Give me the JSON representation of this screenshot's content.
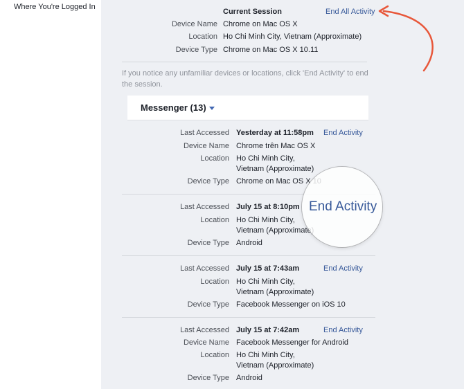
{
  "page": {
    "section_title": "Where You're Logged In"
  },
  "current_session": {
    "title": "Current Session",
    "end_all_label": "End All Activity",
    "device_name_label": "Device Name",
    "device_name": "Chrome on Mac OS X",
    "location_label": "Location",
    "location": "Ho Chi Minh City, Vietnam (Approximate)",
    "device_type_label": "Device Type",
    "device_type": "Chrome on Mac OS X 10.11"
  },
  "notice": "If you notice any unfamiliar devices or locations, click 'End Activity' to end the session.",
  "messenger": {
    "title": "Messenger (13)",
    "sessions": [
      {
        "last_accessed_label": "Last Accessed",
        "last_accessed": "Yesterday at 11:58pm",
        "end_label": "End Activity",
        "device_name_label": "Device Name",
        "device_name": "Chrome trên Mac OS X",
        "location_label": "Location",
        "location_line1": "Ho Chi Minh City,",
        "location_line2": "Vietnam (Approximate)",
        "device_type_label": "Device Type",
        "device_type": "Chrome on Mac OS X 10"
      },
      {
        "last_accessed_label": "Last Accessed",
        "last_accessed": "July 15 at 8:10pm",
        "end_label": "End Activity",
        "location_label": "Location",
        "location_line1": "Ho Chi Minh City,",
        "location_line2": "Vietnam (Approximate)",
        "device_type_label": "Device Type",
        "device_type": "Android"
      },
      {
        "last_accessed_label": "Last Accessed",
        "last_accessed": "July 15 at 7:43am",
        "end_label": "End Activity",
        "location_label": "Location",
        "location_line1": "Ho Chi Minh City,",
        "location_line2": "Vietnam (Approximate)",
        "device_type_label": "Device Type",
        "device_type": "Facebook Messenger on iOS 10"
      },
      {
        "last_accessed_label": "Last Accessed",
        "last_accessed": "July 15 at 7:42am",
        "end_label": "End Activity",
        "device_name_label": "Device Name",
        "device_name": "Facebook Messenger for Android",
        "location_label": "Location",
        "location_line1": "Ho Chi Minh City,",
        "location_line2": "Vietnam (Approximate)",
        "device_type_label": "Device Type",
        "device_type": "Android"
      }
    ]
  },
  "icons": {
    "annotation_arrow": "curved-arrow-icon",
    "dropdown": "caret-down-icon"
  },
  "colors": {
    "link": "#365899",
    "arrow": "#e8573a",
    "panel": "#eef0f4"
  }
}
